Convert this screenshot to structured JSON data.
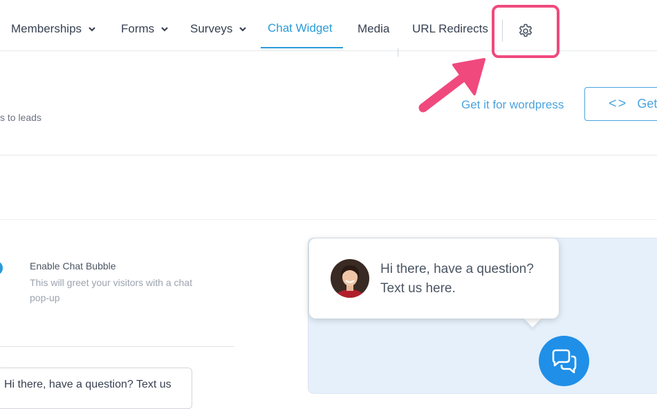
{
  "nav": {
    "items": [
      {
        "label": "Memberships",
        "has_dropdown": true
      },
      {
        "label": "Forms",
        "has_dropdown": true
      },
      {
        "label": "Surveys",
        "has_dropdown": true
      },
      {
        "label": "Chat Widget",
        "active": true
      },
      {
        "label": "Media"
      },
      {
        "label": "URL Redirects"
      }
    ],
    "settings_icon": "gear-icon",
    "accent_color": "#2a9bd8",
    "highlight_color": "#f0497e"
  },
  "header": {
    "subtitle": "s to leads",
    "wordpress_link": "Get it for wordpress",
    "get_code_label": "Get",
    "get_code_icon": "code-icon"
  },
  "settings": {
    "enable_bubble_title": "Enable Chat Bubble",
    "enable_bubble_desc": "This will greet your visitors with a chat pop-up",
    "message_value": "Hi there, have a question? Text us"
  },
  "preview": {
    "bubble_message": "Hi there, have a question? Text us here.",
    "chat_icon": "chat-bubbles-icon",
    "fab_color": "#1f8fe8",
    "bg_color": "#e5f0fb"
  }
}
